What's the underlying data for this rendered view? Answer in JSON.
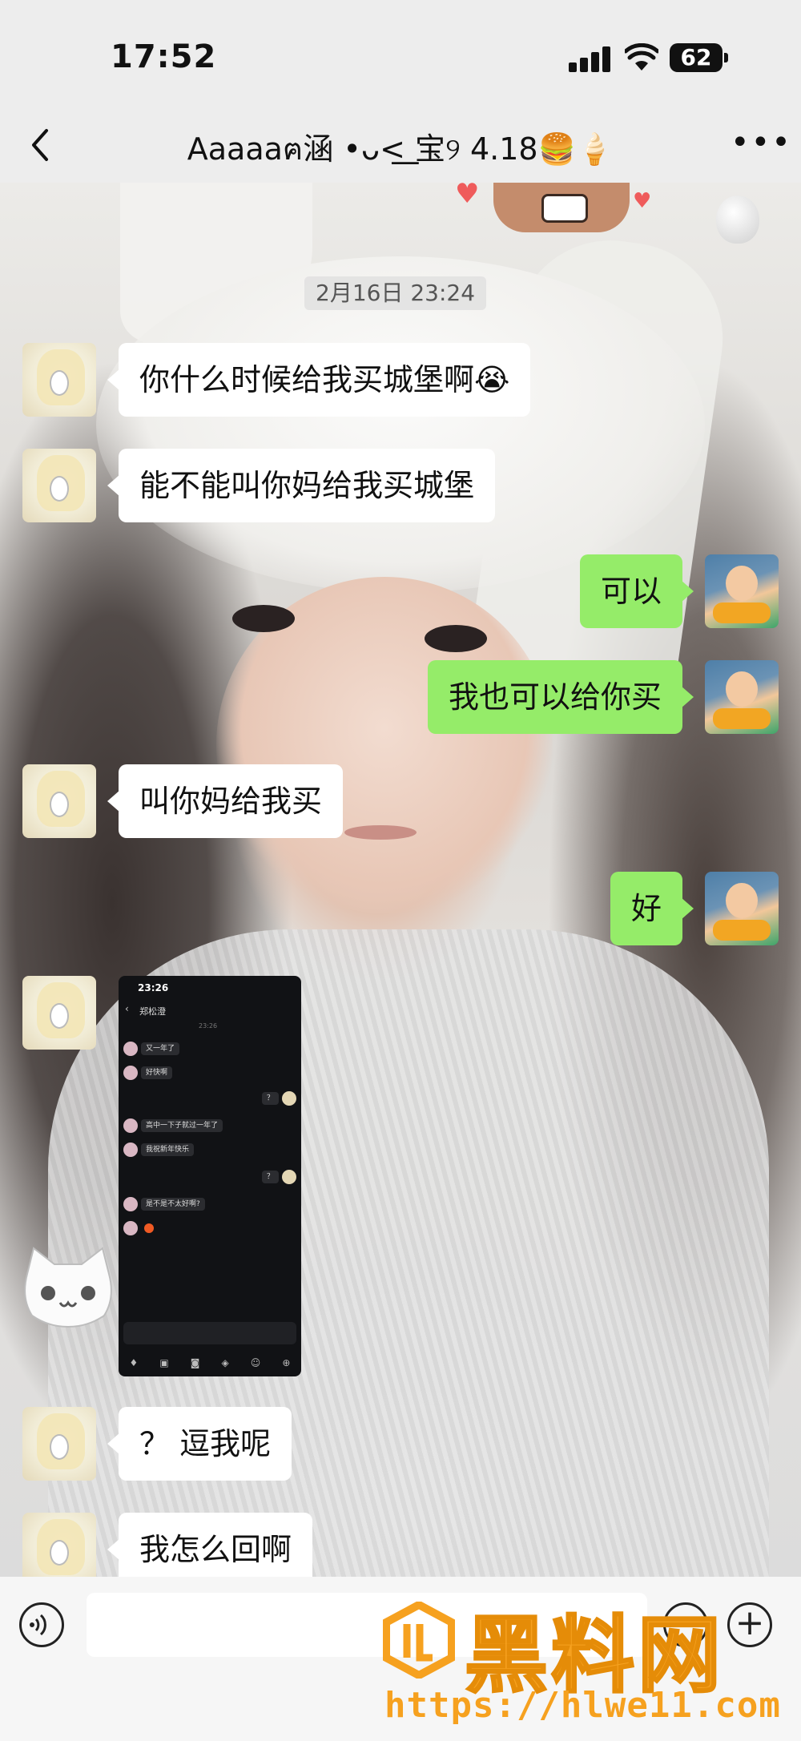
{
  "status_bar": {
    "time": "17:52",
    "battery": "62"
  },
  "nav": {
    "title": "Aaaaaฅ涵 •ᴗ<͟ 宝୨ 4.18🍔🍦"
  },
  "timestamp": "2月16日 23:24",
  "messages": [
    {
      "side": "left",
      "text": "你什么时候给我买城堡啊😭"
    },
    {
      "side": "left",
      "text": "能不能叫你妈给我买城堡"
    },
    {
      "side": "right",
      "text": "可以"
    },
    {
      "side": "right",
      "text": "我也可以给你买"
    },
    {
      "side": "left",
      "text": "叫你妈给我买"
    },
    {
      "side": "right",
      "text": "好"
    },
    {
      "side": "left",
      "text": "？ 逗我呢"
    },
    {
      "side": "left",
      "text": "我怎么回啊"
    }
  ],
  "image_message": {
    "time": "23:26",
    "title": "郑松澄",
    "header_ts": "23:26",
    "rows": [
      {
        "side": "left",
        "text": "又一年了"
      },
      {
        "side": "left",
        "text": "好快啊"
      },
      {
        "side": "right",
        "text": "？"
      },
      {
        "side": "left",
        "text": "高中一下子就过一年了"
      },
      {
        "side": "left",
        "text": "我祝新年快乐"
      },
      {
        "side": "right",
        "text": "？"
      },
      {
        "side": "left",
        "text": "是不是不太好啊?"
      }
    ]
  },
  "watermark": {
    "name": "黑料网",
    "url": "https://hlwe11.com"
  },
  "colors": {
    "sent_bubble": "#95ec69",
    "received_bubble": "#ffffff",
    "watermark": "#f6a11f"
  }
}
